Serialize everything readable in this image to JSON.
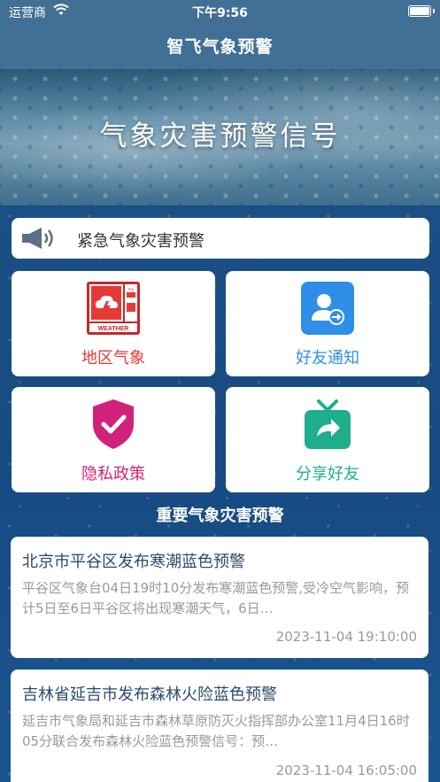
{
  "status_bar": {
    "carrier": "运营商",
    "time": "下午9:56"
  },
  "nav": {
    "title": "智飞气象预警"
  },
  "banner": {
    "title": "气象灾害预警信号"
  },
  "notice": {
    "label": "紧急气象灾害预警"
  },
  "menu": [
    {
      "label": "地区气象",
      "color": "#e53935",
      "icon": "weather-alert-icon"
    },
    {
      "label": "好友通知",
      "color": "#2f8ee8",
      "icon": "friend-notify-icon"
    },
    {
      "label": "隐私政策",
      "color": "#d0227a",
      "icon": "privacy-shield-icon"
    },
    {
      "label": "分享好友",
      "color": "#1fae8c",
      "icon": "share-gift-icon"
    }
  ],
  "weather_icon_text": {
    "badge": "WEATHER",
    "small": "Ka"
  },
  "section": {
    "title": "重要气象灾害预警"
  },
  "news": [
    {
      "title": "北京市平谷区发布寒潮蓝色预警",
      "summary": "平谷区气象台04日19时10分发布寒潮蓝色预警,受冷空气影响，预计5日至6日平谷区将出现寒潮天气，6日…",
      "date": "2023-11-04 19:10:00"
    },
    {
      "title": "吉林省延吉市发布森林火险蓝色预警",
      "summary": "延吉市气象局和延吉市森林草原防灭火指挥部办公室11月4日16时05分联合发布森林火险蓝色预警信号：预…",
      "date": "2023-11-04 16:05:00"
    }
  ]
}
